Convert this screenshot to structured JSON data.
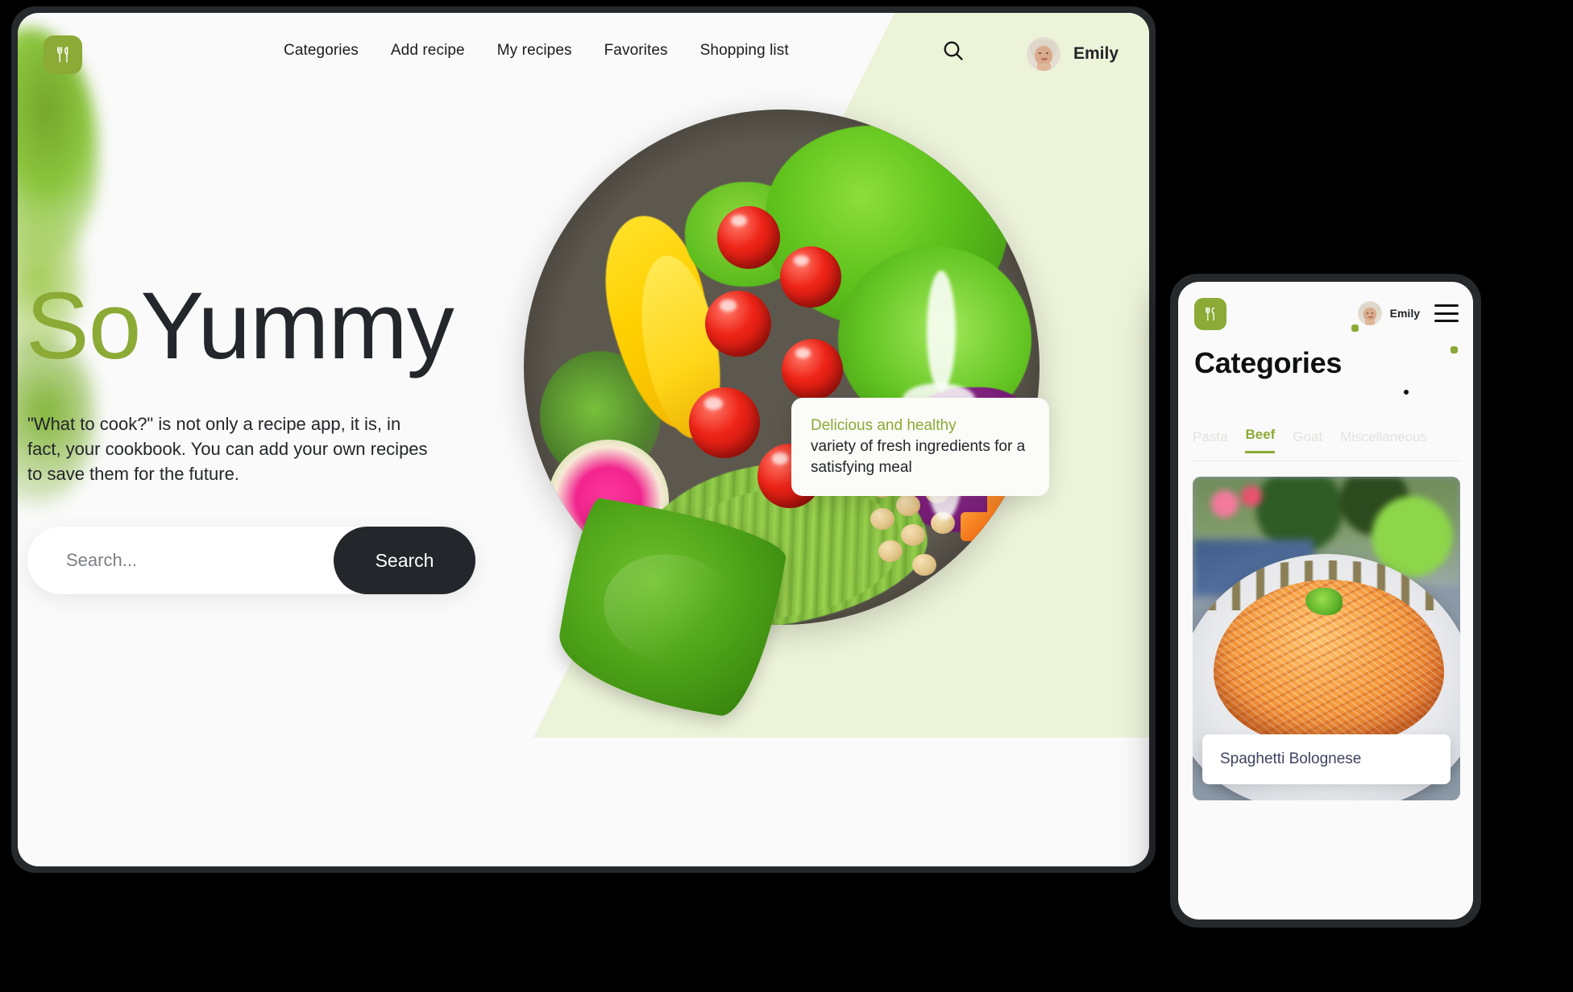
{
  "brand": {
    "name_part_1": "So",
    "name_part_2": "Yummy",
    "logo_icon": "fork-and-knife-icon",
    "accent_green": "#8baa36",
    "dark": "#23262a",
    "pale_green": "#edf3d9"
  },
  "desktop": {
    "nav": [
      {
        "label": "Categories"
      },
      {
        "label": "Add recipe"
      },
      {
        "label": "My recipes"
      },
      {
        "label": "Favorites"
      },
      {
        "label": "Shopping list"
      }
    ],
    "search_icon": "search-icon",
    "user": {
      "name": "Emily",
      "avatar_icon": "user-avatar"
    },
    "hero": {
      "description": "\"What to cook?\" is not only a recipe app, it is, in fact, your cookbook. You can add your own recipes to save them for the future."
    },
    "search": {
      "placeholder": "Search...",
      "value": "",
      "button_label": "Search"
    },
    "promo_card": {
      "line_green": "Delicious and healthy",
      "line_dark_1": "variety of fresh ingredients for a",
      "line_dark_2": "satisfying meal"
    },
    "photo": {
      "alt": "salad-bowl-photo"
    }
  },
  "mobile": {
    "logo_icon": "fork-and-knife-icon",
    "user": {
      "name": "Emily",
      "avatar_icon": "user-avatar"
    },
    "menu_icon": "hamburger-menu-icon",
    "title": "Categories",
    "tabs": [
      {
        "label": "Pasta",
        "active": false
      },
      {
        "label": "Beef",
        "active": true
      },
      {
        "label": "Goat",
        "active": false
      },
      {
        "label": "Miscellaneous",
        "active": false
      }
    ],
    "recipe_card": {
      "title": "Spaghetti Bolognese",
      "photo_alt": "spaghetti-bolognese-photo"
    }
  }
}
